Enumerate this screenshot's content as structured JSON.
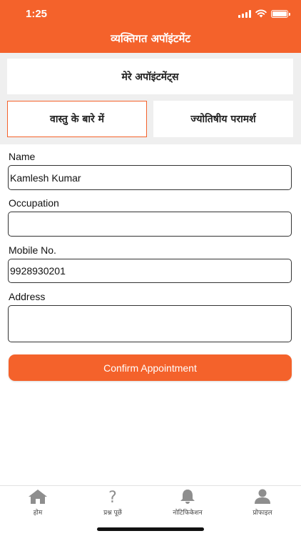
{
  "status_bar": {
    "time": "1:25"
  },
  "header": {
    "title": "व्यक्तिगत अपॉइंटमेंट"
  },
  "appointments_button": {
    "label": "मेरे अपॉइंटमेंट्स"
  },
  "tabs": [
    {
      "label": "वास्तु के बारे में",
      "selected": true
    },
    {
      "label": "ज्योतिषीय परामर्श",
      "selected": false
    }
  ],
  "form": {
    "name_label": "Name",
    "name_value": "Kamlesh Kumar",
    "occupation_label": "Occupation",
    "occupation_value": "",
    "mobile_label": "Mobile No.",
    "mobile_value": "9928930201",
    "address_label": "Address",
    "address_value": "",
    "confirm_label": "Confirm Appointment"
  },
  "tabbar": [
    {
      "label": "होम",
      "icon": "home-icon"
    },
    {
      "label": "प्रश्न पूछें",
      "icon": "question-icon"
    },
    {
      "label": "नोटिफिकेशन",
      "icon": "bell-icon"
    },
    {
      "label": "प्रोफाइल",
      "icon": "profile-icon"
    }
  ],
  "colors": {
    "accent": "#f4622b",
    "background_gray": "#efefef",
    "tab_icon_gray": "#8e8e8e"
  }
}
